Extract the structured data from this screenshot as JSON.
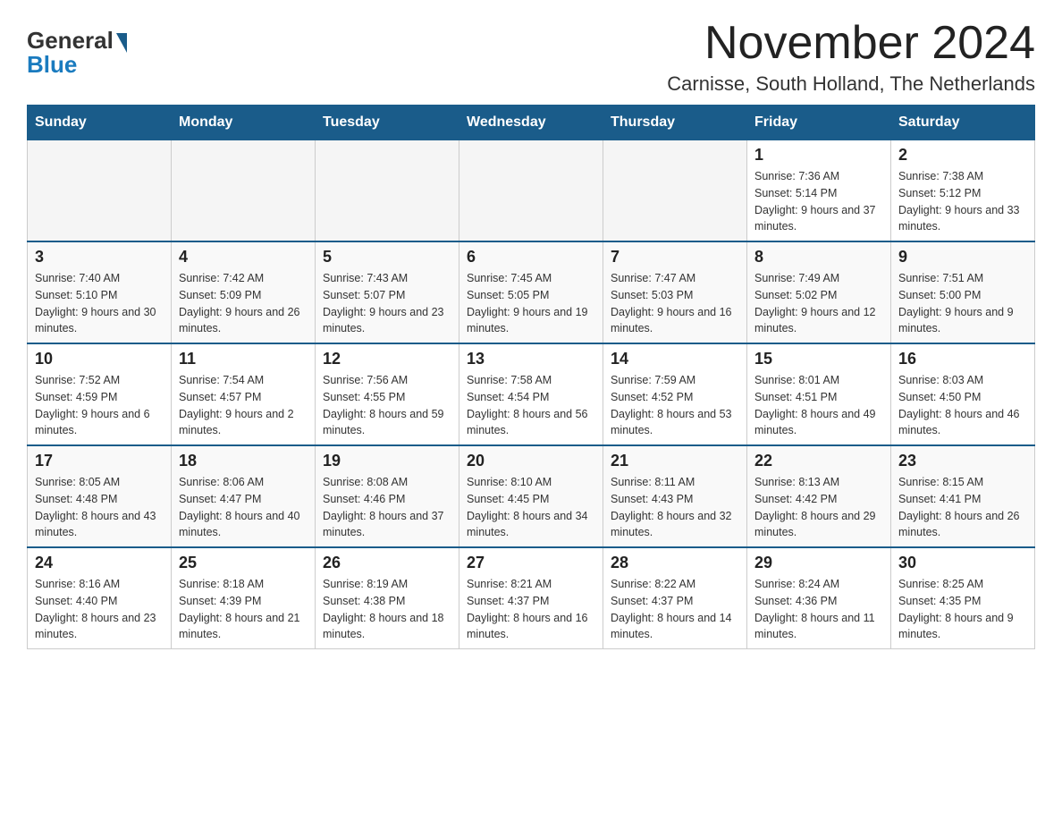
{
  "header": {
    "logo_general": "General",
    "logo_blue": "Blue",
    "month_title": "November 2024",
    "location": "Carnisse, South Holland, The Netherlands"
  },
  "days_of_week": [
    "Sunday",
    "Monday",
    "Tuesday",
    "Wednesday",
    "Thursday",
    "Friday",
    "Saturday"
  ],
  "weeks": [
    [
      {
        "day": "",
        "info": ""
      },
      {
        "day": "",
        "info": ""
      },
      {
        "day": "",
        "info": ""
      },
      {
        "day": "",
        "info": ""
      },
      {
        "day": "",
        "info": ""
      },
      {
        "day": "1",
        "info": "Sunrise: 7:36 AM\nSunset: 5:14 PM\nDaylight: 9 hours and 37 minutes."
      },
      {
        "day": "2",
        "info": "Sunrise: 7:38 AM\nSunset: 5:12 PM\nDaylight: 9 hours and 33 minutes."
      }
    ],
    [
      {
        "day": "3",
        "info": "Sunrise: 7:40 AM\nSunset: 5:10 PM\nDaylight: 9 hours and 30 minutes."
      },
      {
        "day": "4",
        "info": "Sunrise: 7:42 AM\nSunset: 5:09 PM\nDaylight: 9 hours and 26 minutes."
      },
      {
        "day": "5",
        "info": "Sunrise: 7:43 AM\nSunset: 5:07 PM\nDaylight: 9 hours and 23 minutes."
      },
      {
        "day": "6",
        "info": "Sunrise: 7:45 AM\nSunset: 5:05 PM\nDaylight: 9 hours and 19 minutes."
      },
      {
        "day": "7",
        "info": "Sunrise: 7:47 AM\nSunset: 5:03 PM\nDaylight: 9 hours and 16 minutes."
      },
      {
        "day": "8",
        "info": "Sunrise: 7:49 AM\nSunset: 5:02 PM\nDaylight: 9 hours and 12 minutes."
      },
      {
        "day": "9",
        "info": "Sunrise: 7:51 AM\nSunset: 5:00 PM\nDaylight: 9 hours and 9 minutes."
      }
    ],
    [
      {
        "day": "10",
        "info": "Sunrise: 7:52 AM\nSunset: 4:59 PM\nDaylight: 9 hours and 6 minutes."
      },
      {
        "day": "11",
        "info": "Sunrise: 7:54 AM\nSunset: 4:57 PM\nDaylight: 9 hours and 2 minutes."
      },
      {
        "day": "12",
        "info": "Sunrise: 7:56 AM\nSunset: 4:55 PM\nDaylight: 8 hours and 59 minutes."
      },
      {
        "day": "13",
        "info": "Sunrise: 7:58 AM\nSunset: 4:54 PM\nDaylight: 8 hours and 56 minutes."
      },
      {
        "day": "14",
        "info": "Sunrise: 7:59 AM\nSunset: 4:52 PM\nDaylight: 8 hours and 53 minutes."
      },
      {
        "day": "15",
        "info": "Sunrise: 8:01 AM\nSunset: 4:51 PM\nDaylight: 8 hours and 49 minutes."
      },
      {
        "day": "16",
        "info": "Sunrise: 8:03 AM\nSunset: 4:50 PM\nDaylight: 8 hours and 46 minutes."
      }
    ],
    [
      {
        "day": "17",
        "info": "Sunrise: 8:05 AM\nSunset: 4:48 PM\nDaylight: 8 hours and 43 minutes."
      },
      {
        "day": "18",
        "info": "Sunrise: 8:06 AM\nSunset: 4:47 PM\nDaylight: 8 hours and 40 minutes."
      },
      {
        "day": "19",
        "info": "Sunrise: 8:08 AM\nSunset: 4:46 PM\nDaylight: 8 hours and 37 minutes."
      },
      {
        "day": "20",
        "info": "Sunrise: 8:10 AM\nSunset: 4:45 PM\nDaylight: 8 hours and 34 minutes."
      },
      {
        "day": "21",
        "info": "Sunrise: 8:11 AM\nSunset: 4:43 PM\nDaylight: 8 hours and 32 minutes."
      },
      {
        "day": "22",
        "info": "Sunrise: 8:13 AM\nSunset: 4:42 PM\nDaylight: 8 hours and 29 minutes."
      },
      {
        "day": "23",
        "info": "Sunrise: 8:15 AM\nSunset: 4:41 PM\nDaylight: 8 hours and 26 minutes."
      }
    ],
    [
      {
        "day": "24",
        "info": "Sunrise: 8:16 AM\nSunset: 4:40 PM\nDaylight: 8 hours and 23 minutes."
      },
      {
        "day": "25",
        "info": "Sunrise: 8:18 AM\nSunset: 4:39 PM\nDaylight: 8 hours and 21 minutes."
      },
      {
        "day": "26",
        "info": "Sunrise: 8:19 AM\nSunset: 4:38 PM\nDaylight: 8 hours and 18 minutes."
      },
      {
        "day": "27",
        "info": "Sunrise: 8:21 AM\nSunset: 4:37 PM\nDaylight: 8 hours and 16 minutes."
      },
      {
        "day": "28",
        "info": "Sunrise: 8:22 AM\nSunset: 4:37 PM\nDaylight: 8 hours and 14 minutes."
      },
      {
        "day": "29",
        "info": "Sunrise: 8:24 AM\nSunset: 4:36 PM\nDaylight: 8 hours and 11 minutes."
      },
      {
        "day": "30",
        "info": "Sunrise: 8:25 AM\nSunset: 4:35 PM\nDaylight: 8 hours and 9 minutes."
      }
    ]
  ]
}
